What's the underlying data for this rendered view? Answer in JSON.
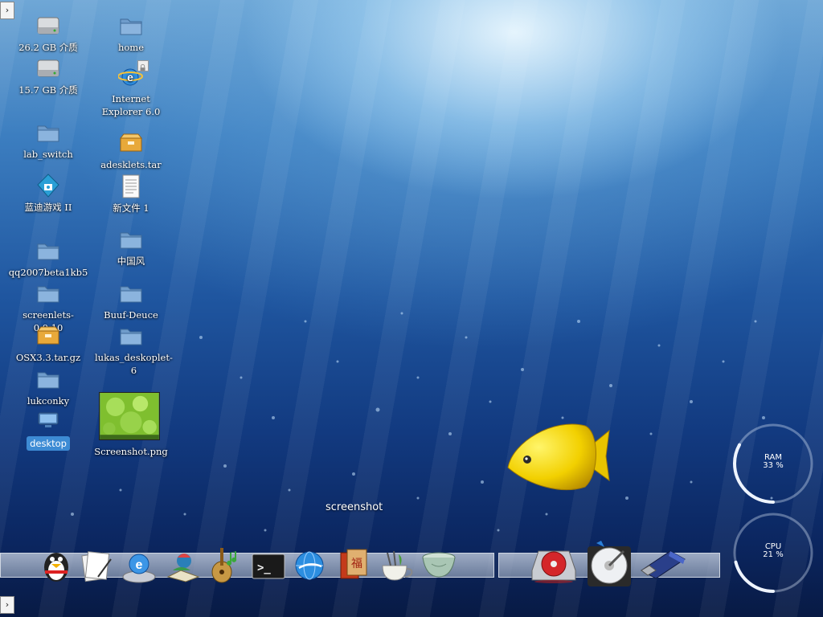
{
  "desktop": {
    "icons": [
      {
        "name": "drive-icon",
        "label": "26.2 GB 介质"
      },
      {
        "name": "drive-icon",
        "label": "15.7 GB 介质"
      },
      {
        "name": "folder-icon",
        "label": "lab_switch"
      },
      {
        "name": "game-icon",
        "label": "蓝迪游戏 II"
      },
      {
        "name": "folder-icon",
        "label": "qq2007beta1kb5"
      },
      {
        "name": "folder-icon",
        "label": "screenlets-0.0.10"
      },
      {
        "name": "archive-icon",
        "label": "OSX3.3.tar.gz"
      },
      {
        "name": "folder-icon",
        "label": "lukconky"
      },
      {
        "name": "desktop-icon",
        "label": "desktop"
      },
      {
        "name": "home-folder-icon",
        "label": "home"
      },
      {
        "name": "internet-explorer-icon",
        "label": "Internet Explorer 6.0"
      },
      {
        "name": "archive-icon",
        "label": "adesklets.tar"
      },
      {
        "name": "text-file-icon",
        "label": "新文件 1"
      },
      {
        "name": "folder-icon",
        "label": "中国风"
      },
      {
        "name": "folder-icon",
        "label": "Buuf-Deuce"
      },
      {
        "name": "folder-icon",
        "label": "lukas_deskoplet-6"
      },
      {
        "name": "image-thumbnail",
        "label": "Screenshot.png"
      }
    ]
  },
  "dock": {
    "tooltip": "screenshot",
    "left_items": [
      "qq-penguin-icon",
      "notes-icon",
      "internet-explorer-icon",
      "paint-icon",
      "music-icon",
      "terminal-icon",
      "browser-globe-icon",
      "red-book-icon",
      "tea-cup-icon",
      "bowl-icon"
    ],
    "right_items": [
      "cd-drive-icon",
      "hard-disk-icon",
      "usb-drive-icon"
    ]
  },
  "meters": {
    "ram": {
      "label": "RAM",
      "value": "33 %",
      "fraction": 0.33
    },
    "cpu": {
      "label": "CPU",
      "value": "21 %",
      "fraction": 0.21
    }
  },
  "corner_buttons": {
    "top": "›",
    "bottom": "›"
  }
}
